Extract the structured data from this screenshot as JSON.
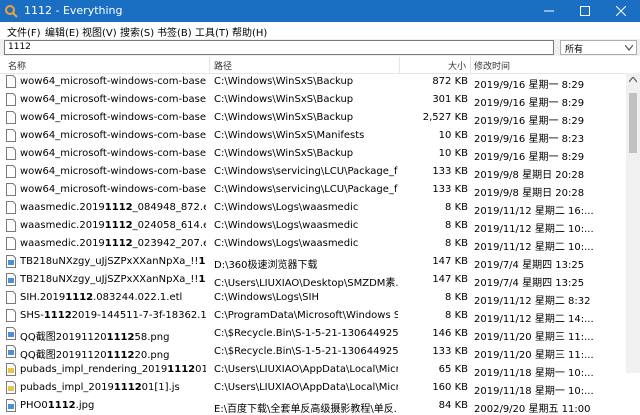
{
  "window": {
    "title": "1112 - Everything",
    "accent": "#1b6fc2"
  },
  "menu": [
    "文件(F)",
    "编辑(E)",
    "视图(V)",
    "搜索(S)",
    "书签(B)",
    "工具(T)",
    "帮助(H)"
  ],
  "search": {
    "value": "1112",
    "filter": "所有"
  },
  "columns": {
    "name": "名称",
    "path": "路径",
    "size": "大小",
    "date": "修改时间"
  },
  "rows": [
    {
      "pre": "wow64_microsoft-windows-com-base_...",
      "hl": "",
      "post": "",
      "path": "C:\\Windows\\WinSxS\\Backup",
      "size": "872 KB",
      "date": "2019/9/16 星期一 8:29",
      "icon": "generic-file"
    },
    {
      "pre": "wow64_microsoft-windows-com-base_...",
      "hl": "",
      "post": "",
      "path": "C:\\Windows\\WinSxS\\Backup",
      "size": "301 KB",
      "date": "2019/9/16 星期一 8:29",
      "icon": "generic-file"
    },
    {
      "pre": "wow64_microsoft-windows-com-base_...",
      "hl": "",
      "post": "",
      "path": "C:\\Windows\\WinSxS\\Backup",
      "size": "2,527 KB",
      "date": "2019/9/16 星期一 8:29",
      "icon": "generic-file"
    },
    {
      "pre": "wow64_microsoft-windows-com-base_...",
      "hl": "",
      "post": "",
      "path": "C:\\Windows\\WinSxS\\Manifests",
      "size": "10 KB",
      "date": "2019/9/16 星期一 8:23",
      "icon": "generic-file"
    },
    {
      "pre": "wow64_microsoft-windows-com-base_...",
      "hl": "",
      "post": "",
      "path": "C:\\Windows\\WinSxS\\Backup",
      "size": "10 KB",
      "date": "2019/9/16 星期一 8:29",
      "icon": "generic-file"
    },
    {
      "pre": "wow64_microsoft-windows-com-base_...",
      "hl": "",
      "post": "",
      "path": "C:\\Windows\\servicing\\LCU\\Package_fo...",
      "size": "133 KB",
      "date": "2019/9/8 星期日 20:28",
      "icon": "generic-file"
    },
    {
      "pre": "wow64_microsoft-windows-com-base_...",
      "hl": "",
      "post": "",
      "path": "C:\\Windows\\servicing\\LCU\\Package_fo...",
      "size": "133 KB",
      "date": "2019/9/8 星期日 20:28",
      "icon": "generic-file"
    },
    {
      "pre": "waasmedic.2019",
      "hl": "1112",
      "post": "_084948_872.etl",
      "path": "C:\\Windows\\Logs\\waasmedic",
      "size": "8 KB",
      "date": "2019/11/12 星期二 16:...",
      "icon": "generic-file"
    },
    {
      "pre": "waasmedic.2019",
      "hl": "1112",
      "post": "_024058_614.etl",
      "path": "C:\\Windows\\Logs\\waasmedic",
      "size": "8 KB",
      "date": "2019/11/12 星期二 10:...",
      "icon": "generic-file"
    },
    {
      "pre": "waasmedic.2019",
      "hl": "1112",
      "post": "_023942_207.etl",
      "path": "C:\\Windows\\Logs\\waasmedic",
      "size": "8 KB",
      "date": "2019/11/12 星期二 10:...",
      "icon": "generic-file"
    },
    {
      "pre": "TB218uNXzgy_uJjSZPxXXanNpXa_!!",
      "hl": "111",
      "post": "...",
      "path": "D:\\360极速浏览器下载",
      "size": "147 KB",
      "date": "2019/7/4 星期四 13:25",
      "icon": "image-file"
    },
    {
      "pre": "TB218uNXzgy_uJjSZPxXXanNpXa_!!",
      "hl": "111",
      "post": "...",
      "path": "C:\\Users\\LIUXIAO\\Desktop\\SMZDM素...",
      "size": "147 KB",
      "date": "2019/7/4 星期四 13:25",
      "icon": "image-file"
    },
    {
      "pre": "SIH.2019",
      "hl": "1112",
      "post": ".083244.022.1.etl",
      "path": "C:\\Windows\\Logs\\SIH",
      "size": "8 KB",
      "date": "2019/11/12 星期二 8:32",
      "icon": "generic-file"
    },
    {
      "pre": "SHS-",
      "hl": "1112",
      "post": "2019-144511-7-3f-18362.1.a...",
      "path": "C:\\ProgramData\\Microsoft\\Windows S...",
      "size": "8 KB",
      "date": "2019/11/12 星期二 14:...",
      "icon": "generic-file"
    },
    {
      "pre": "QQ截图20191120",
      "hl": "1112",
      "post": "58.png",
      "path": "C:\\$Recycle.Bin\\S-1-5-21-1306449259-...",
      "size": "146 KB",
      "date": "2019/11/20 星期三 11:...",
      "icon": "image-file"
    },
    {
      "pre": "QQ截图20191120",
      "hl": "1112",
      "post": "20.png",
      "path": "C:\\$Recycle.Bin\\S-1-5-21-1306449259-...",
      "size": "133 KB",
      "date": "2019/11/20 星期三 11:...",
      "icon": "image-file"
    },
    {
      "pre": "pubads_impl_rendering_2019",
      "hl": "1112",
      "post": "01[1].js",
      "path": "C:\\Users\\LIUXIAO\\AppData\\Local\\Micr...",
      "size": "65 KB",
      "date": "2019/11/18 星期一 10:...",
      "icon": "js-file"
    },
    {
      "pre": "pubads_impl_2019",
      "hl": "1112",
      "post": "01[1].js",
      "path": "C:\\Users\\LIUXIAO\\AppData\\Local\\Micr...",
      "size": "160 KB",
      "date": "2019/11/18 星期一 10:...",
      "icon": "js-file"
    },
    {
      "pre": "PHO0",
      "hl": "1112",
      "post": ".jpg",
      "path": "E:\\百度下载\\全套单反高级摄影教程\\单反...",
      "size": "84 KB",
      "date": "2002/9/20 星期五 11:00",
      "icon": "image-file"
    }
  ]
}
